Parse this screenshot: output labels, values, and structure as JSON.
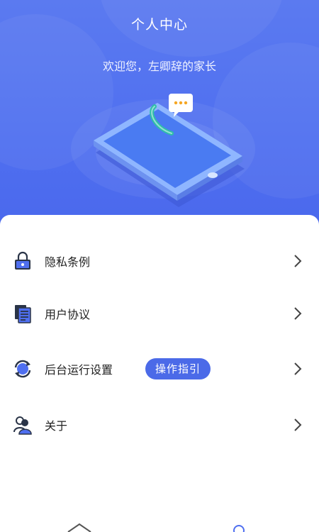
{
  "header": {
    "title": "个人中心",
    "welcome": "欢迎您，左卿辞的家长"
  },
  "menu": {
    "items": [
      {
        "label": "隐私条例",
        "icon": "lock-icon"
      },
      {
        "label": "用户协议",
        "icon": "document-icon"
      },
      {
        "label": "后台运行设置",
        "icon": "refresh-icon",
        "badge": "操作指引"
      },
      {
        "label": "关于",
        "icon": "users-icon"
      }
    ]
  },
  "bottom_nav": {
    "icons": [
      "home-icon",
      "profile-icon"
    ]
  },
  "colors": {
    "primary": "#4f6ff0",
    "icon_dark": "#2a3447",
    "accent_orange": "#f5a623"
  }
}
